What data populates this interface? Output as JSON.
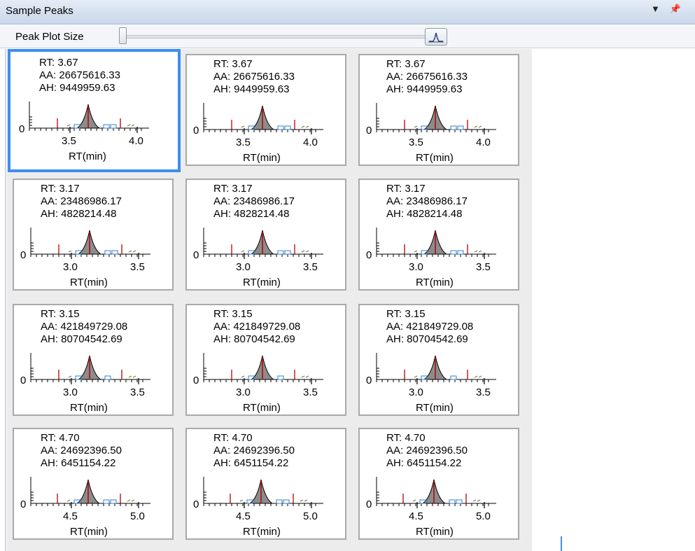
{
  "window": {
    "title": "Sample Peaks",
    "pin_icon": "pin-icon",
    "dropdown_icon": "chevron-down-icon",
    "close_icon": "close-icon"
  },
  "toolbar": {
    "label": "Peak Plot Size",
    "slider_value": 0,
    "button_icon": "peak-plot-icon"
  },
  "colors": {
    "selection": "#3c8ef0",
    "peak_fill": "#8c8c8c",
    "marker_red": "#b40000",
    "baseline_blue": "#3a7fc4"
  },
  "rows": [
    {
      "rt": "RT: 3.67",
      "aa": "AA: 26675616.33",
      "ah": "AH: 9449959.63",
      "tick1": "3.5",
      "tick2": "4.0",
      "xlabel": "RT(min)",
      "y0": "0",
      "chart_data": {
        "type": "line",
        "xlabel": "RT(min)",
        "xticks": [
          3.5,
          4.0
        ],
        "ytick": 0,
        "peak_rt": 3.67
      }
    },
    {
      "rt": "RT: 3.17",
      "aa": "AA: 23486986.17",
      "ah": "AH: 4828214.48",
      "tick1": "3.0",
      "tick2": "3.5",
      "xlabel": "RT(min)",
      "y0": "0",
      "chart_data": {
        "type": "line",
        "xlabel": "RT(min)",
        "xticks": [
          3.0,
          3.5
        ],
        "ytick": 0,
        "peak_rt": 3.17
      }
    },
    {
      "rt": "RT: 3.15",
      "aa": "AA: 421849729.08",
      "ah": "AH: 80704542.69",
      "tick1": "3.0",
      "tick2": "3.5",
      "xlabel": "RT(min)",
      "y0": "0",
      "chart_data": {
        "type": "line",
        "xlabel": "RT(min)",
        "xticks": [
          3.0,
          3.5
        ],
        "ytick": 0,
        "peak_rt": 3.15
      }
    },
    {
      "rt": "RT: 4.70",
      "aa": "AA: 24692396.50",
      "ah": "AH: 6451154.22",
      "tick1": "4.5",
      "tick2": "5.0",
      "xlabel": "RT(min)",
      "y0": "0",
      "chart_data": {
        "type": "line",
        "xlabel": "RT(min)",
        "xticks": [
          4.5,
          5.0
        ],
        "ytick": 0,
        "peak_rt": 4.7
      }
    }
  ]
}
